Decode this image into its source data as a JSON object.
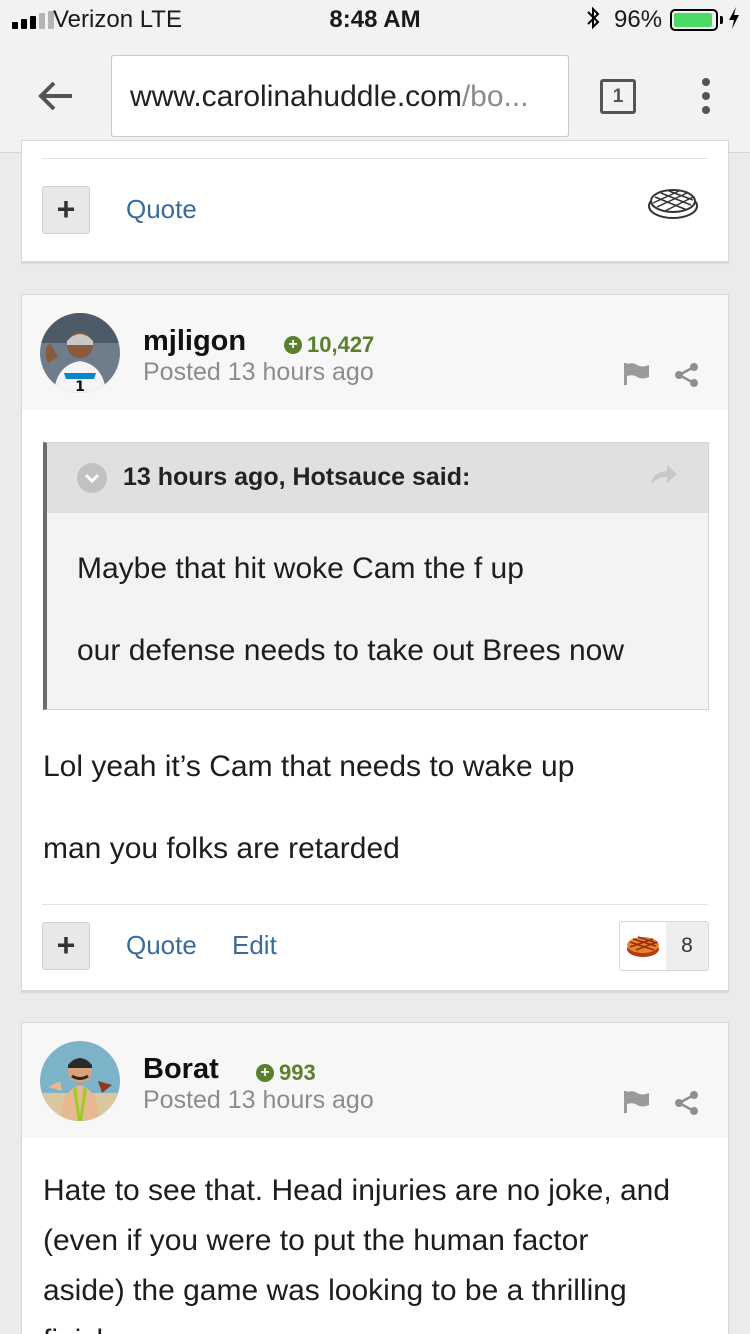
{
  "status_bar": {
    "carrier": "Verizon  LTE",
    "time": "8:48 AM",
    "battery_percent": "96%",
    "battery_level": 0.96,
    "battery_color": "#4cd964"
  },
  "browser": {
    "url_host": "www.carolinahuddle.com",
    "url_path": "/bo...",
    "tab_count": "1"
  },
  "colors": {
    "link": "#3a6b9c",
    "reputation": "#5c7f2e"
  },
  "prev_post": {
    "quote_label": "Quote",
    "reaction_icon": "pie-outline-icon"
  },
  "posts": [
    {
      "author": "mjligon",
      "reputation": "10,427",
      "posted": "Posted 13 hours ago",
      "avatar_icon": "football-player-avatar",
      "quote": {
        "citation": "13 hours ago, Hotsauce said:",
        "lines": [
          "Maybe that hit woke Cam the f up",
          "our defense needs to take out Brees now"
        ]
      },
      "body": [
        "Lol yeah it’s Cam that needs to wake up",
        "man you folks are retarded"
      ],
      "actions": {
        "quote_label": "Quote",
        "edit_label": "Edit"
      },
      "reaction": {
        "icon": "pie-icon",
        "count": "8"
      }
    },
    {
      "author": "Borat",
      "reputation": "993",
      "posted": "Posted 13 hours ago",
      "avatar_icon": "borat-avatar",
      "body": [
        "Hate to see that. Head injuries are no joke, and",
        "(even if you were to put the human factor",
        "aside) the game was looking to be a thrilling",
        "finish..."
      ]
    }
  ]
}
